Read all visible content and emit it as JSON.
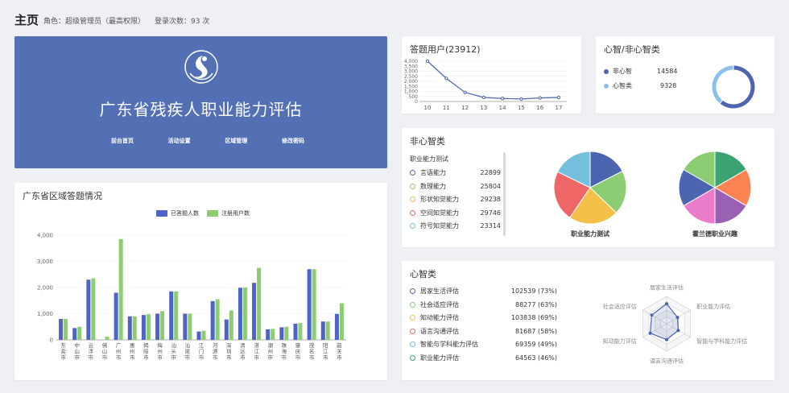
{
  "header": {
    "title": "主页",
    "role": "角色：超级管理员（最高权限）",
    "login": "登录次数：93 次"
  },
  "banner": {
    "title": "广东省残疾人职业能力评估",
    "links": [
      "前台首页",
      "活动设置",
      "区域管理",
      "修改密码"
    ]
  },
  "answer_users": {
    "title": "答题用户(23912)",
    "chart_data": {
      "type": "line",
      "x": [
        "10",
        "11",
        "12",
        "13",
        "14",
        "15",
        "16",
        "17"
      ],
      "values": [
        4000,
        2300,
        900,
        400,
        300,
        250,
        350,
        400
      ],
      "ylim": [
        0,
        4000
      ],
      "yticks": [
        "0",
        "500",
        "1,000",
        "1,500",
        "2,000",
        "2,500",
        "3,000",
        "3,500",
        "4,000"
      ]
    }
  },
  "mind_vs": {
    "title": "心智/非心智类",
    "items": [
      {
        "label": "非心智",
        "value": "14584",
        "color": "#4d64b0"
      },
      {
        "label": "心智类",
        "value": "9328",
        "color": "#8cc0ec"
      }
    ],
    "chart_data": {
      "type": "pie",
      "categories": [
        "非心智",
        "心智类"
      ],
      "values": [
        14584,
        9328
      ]
    }
  },
  "region": {
    "title": "广东省区域答题情况",
    "legend": [
      {
        "label": "已答题人数",
        "color": "#4d64c4"
      },
      {
        "label": "注册用户数",
        "color": "#8ccc72"
      }
    ],
    "chart_data": {
      "type": "bar",
      "categories": [
        "东莞市",
        "中山市",
        "云浮市",
        "佛山市",
        "广州市",
        "惠州市",
        "揭阳市",
        "梅州市",
        "汕头市",
        "汕尾市",
        "江门市",
        "河源市",
        "深圳市",
        "清远市",
        "湛江市",
        "潮州市",
        "珠海市",
        "肇庆市",
        "茂名市",
        "阳江市",
        "韶关市"
      ],
      "series": [
        {
          "name": "已答题人数",
          "values": [
            800,
            450,
            2300,
            0,
            1800,
            900,
            950,
            1000,
            1850,
            1000,
            320,
            1480,
            780,
            1990,
            2180,
            400,
            480,
            620,
            2700,
            700,
            990
          ]
        },
        {
          "name": "注册用户数",
          "values": [
            800,
            500,
            2350,
            120,
            3850,
            900,
            980,
            1100,
            1850,
            1000,
            350,
            1550,
            1120,
            2000,
            2750,
            420,
            500,
            640,
            2700,
            700,
            1400
          ]
        }
      ],
      "ylim": [
        0,
        4000
      ],
      "yticks": [
        "0",
        "1,000",
        "2,000",
        "3,000",
        "4,000"
      ]
    }
  },
  "non_mind": {
    "title": "非心智类",
    "subtitle": "职业能力测试",
    "items": [
      {
        "label": "言语能力",
        "value": "22899",
        "color": "#4d64b0"
      },
      {
        "label": "数理能力",
        "value": "25804",
        "color": "#8ccc72"
      },
      {
        "label": "形状知觉能力",
        "value": "29238",
        "color": "#f5c04a"
      },
      {
        "label": "空间知觉能力",
        "value": "29746",
        "color": "#ee6666"
      },
      {
        "label": "符号知觉能力",
        "value": "23314",
        "color": "#73c0de"
      }
    ],
    "pie1": {
      "label": "职业能力测试",
      "chart_data": {
        "type": "pie",
        "categories": [
          "言语能力",
          "数理能力",
          "形状知觉能力",
          "空间知觉能力",
          "符号知觉能力"
        ],
        "values": [
          22899,
          25804,
          29238,
          29746,
          23314
        ],
        "colors": [
          "#4d64b0",
          "#8ccc72",
          "#f5c04a",
          "#ee6666",
          "#73c0de"
        ]
      }
    },
    "pie2": {
      "label": "霍兰德职业兴趣",
      "chart_data": {
        "type": "pie",
        "values": [
          1,
          1,
          1,
          1,
          1,
          1
        ],
        "colors": [
          "#3ba272",
          "#fc8452",
          "#9a60b4",
          "#ea7ccc",
          "#4d64b0",
          "#8ccc72"
        ]
      }
    }
  },
  "mind": {
    "title": "心智类",
    "items": [
      {
        "label": "居家生活评估",
        "value": "102539 (73%)",
        "color": "#4d64b0"
      },
      {
        "label": "社会适应评估",
        "value": "88277 (63%)",
        "color": "#8ccc72"
      },
      {
        "label": "知动能力评估",
        "value": "103838 (69%)",
        "color": "#f5c04a"
      },
      {
        "label": "语言沟通评估",
        "value": "81687 (58%)",
        "color": "#ee6666"
      },
      {
        "label": "智能与学科能力评估",
        "value": "69359 (49%)",
        "color": "#73c0de"
      },
      {
        "label": "职业能力评估",
        "value": "64563 (46%)",
        "color": "#3ba272"
      }
    ],
    "radar": {
      "axes": [
        "居家生活评估",
        "职业能力评估",
        "智能与学科能力评估",
        "语言沟通评估",
        "知动能力评估",
        "社会适应评估"
      ],
      "values": [
        0.73,
        0.46,
        0.49,
        0.58,
        0.69,
        0.63
      ]
    }
  }
}
